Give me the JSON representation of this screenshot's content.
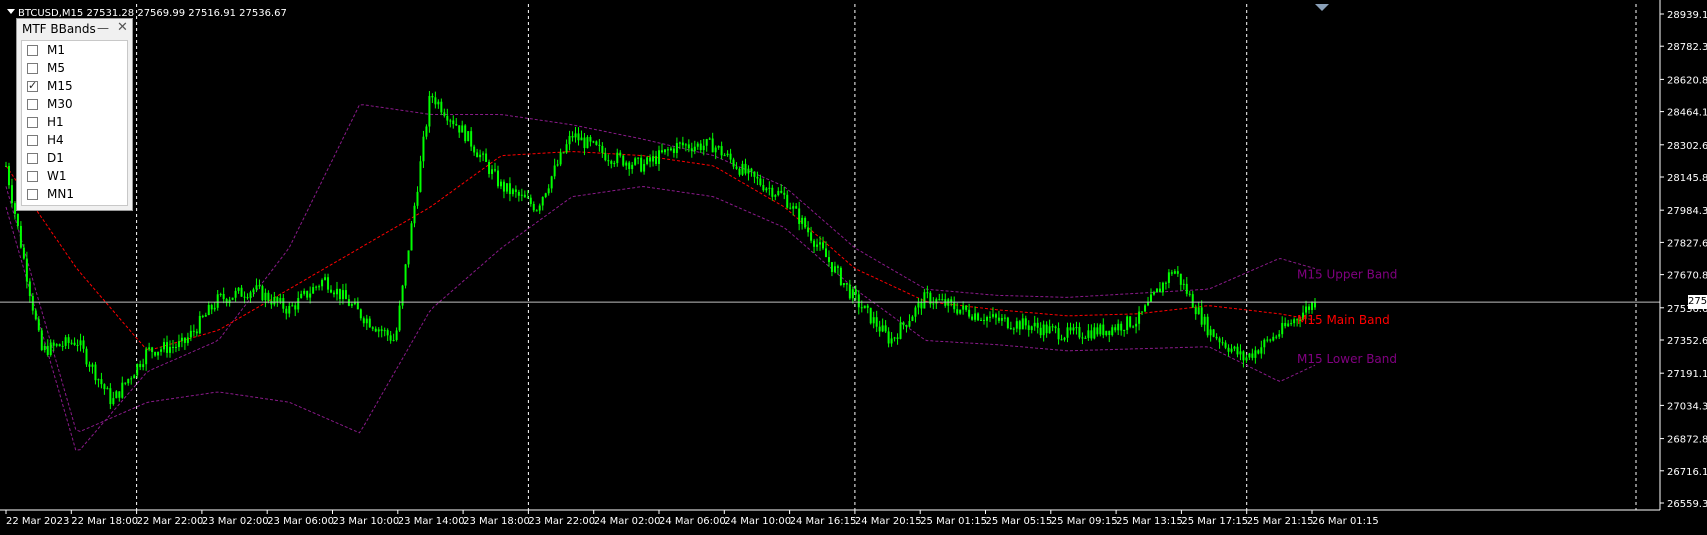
{
  "window": {
    "title": "BTCUSD,M15  27531.28 27569.99 27516.91 27536.67",
    "current_price": "27536.67"
  },
  "indicator_panel": {
    "title": "MTF BBands",
    "minimize_glyph": "—",
    "close_glyph": "✕",
    "items": [
      {
        "label": "M1",
        "checked": false
      },
      {
        "label": "M5",
        "checked": false
      },
      {
        "label": "M15",
        "checked": true
      },
      {
        "label": "M30",
        "checked": false
      },
      {
        "label": "H1",
        "checked": false
      },
      {
        "label": "H4",
        "checked": false
      },
      {
        "label": "D1",
        "checked": false
      },
      {
        "label": "W1",
        "checked": false
      },
      {
        "label": "MN1",
        "checked": false
      }
    ]
  },
  "chart_data": {
    "type": "candlestick",
    "symbol": "BTCUSD",
    "timeframe": "M15",
    "y_ticks": [
      "28939.10",
      "28782.35",
      "28620.80",
      "28464.10",
      "28302.60",
      "28145.85",
      "27984.35",
      "27827.60",
      "27670.80",
      "27536.67",
      "27352.60",
      "27191.10",
      "27034.35",
      "26872.80",
      "26716.10",
      "26559.35"
    ],
    "y_tick_values": [
      28939.1,
      28782.35,
      28620.8,
      28464.1,
      28302.6,
      28145.85,
      27984.35,
      27827.6,
      27670.8,
      27509.35,
      27352.6,
      27191.1,
      27034.35,
      26872.8,
      26716.1,
      26559.35
    ],
    "ylim": [
      26550,
      28960
    ],
    "x_ticks": [
      "22 Mar 2023",
      "22 Mar 18:00",
      "22 Mar 22:00",
      "23 Mar 02:00",
      "23 Mar 06:00",
      "23 Mar 10:00",
      "23 Mar 14:00",
      "23 Mar 18:00",
      "23 Mar 22:00",
      "24 Mar 02:00",
      "24 Mar 06:00",
      "24 Mar 10:00",
      "24 Mar 16:15",
      "24 Mar 20:15",
      "25 Mar 01:15",
      "25 Mar 05:15",
      "25 Mar 09:15",
      "25 Mar 13:15",
      "25 Mar 17:15",
      "25 Mar 21:15",
      "26 Mar 01:15"
    ],
    "day_separators_index": [
      2,
      8,
      13,
      19
    ],
    "series_path": [
      [
        0,
        28200
      ],
      [
        1,
        27300
      ],
      [
        2,
        27350
      ],
      [
        3,
        27050
      ],
      [
        4,
        27300
      ],
      [
        5,
        27330
      ],
      [
        6,
        27550
      ],
      [
        7,
        27600
      ],
      [
        8,
        27500
      ],
      [
        9,
        27650
      ],
      [
        10,
        27480
      ],
      [
        11,
        27350
      ],
      [
        12,
        28550
      ],
      [
        13,
        28350
      ],
      [
        14,
        28100
      ],
      [
        15,
        28000
      ],
      [
        16,
        28350
      ],
      [
        17,
        28250
      ],
      [
        18,
        28200
      ],
      [
        19,
        28300
      ],
      [
        20,
        28300
      ],
      [
        21,
        28150
      ],
      [
        22,
        28050
      ],
      [
        23,
        27800
      ],
      [
        24,
        27550
      ],
      [
        25,
        27350
      ],
      [
        26,
        27560
      ],
      [
        27,
        27500
      ],
      [
        28,
        27450
      ],
      [
        29,
        27420
      ],
      [
        30,
        27380
      ],
      [
        31,
        27400
      ],
      [
        32,
        27450
      ],
      [
        33,
        27700
      ],
      [
        34,
        27400
      ],
      [
        35,
        27260
      ],
      [
        36,
        27390
      ],
      [
        37,
        27540
      ]
    ],
    "upper_band": [
      [
        0,
        28000
      ],
      [
        2,
        26800
      ],
      [
        4,
        27200
      ],
      [
        6,
        27350
      ],
      [
        8,
        27800
      ],
      [
        10,
        28500
      ],
      [
        12,
        28450
      ],
      [
        14,
        28450
      ],
      [
        16,
        28400
      ],
      [
        18,
        28330
      ],
      [
        20,
        28250
      ],
      [
        22,
        28100
      ],
      [
        24,
        27800
      ],
      [
        26,
        27600
      ],
      [
        28,
        27570
      ],
      [
        30,
        27560
      ],
      [
        32,
        27580
      ],
      [
        34,
        27600
      ],
      [
        36,
        27750
      ],
      [
        37,
        27700
      ]
    ],
    "main_band": [
      [
        0,
        28200
      ],
      [
        2,
        27700
      ],
      [
        4,
        27300
      ],
      [
        6,
        27400
      ],
      [
        8,
        27600
      ],
      [
        10,
        27800
      ],
      [
        12,
        28000
      ],
      [
        14,
        28250
      ],
      [
        16,
        28270
      ],
      [
        18,
        28250
      ],
      [
        20,
        28200
      ],
      [
        22,
        28000
      ],
      [
        24,
        27700
      ],
      [
        26,
        27540
      ],
      [
        28,
        27500
      ],
      [
        30,
        27470
      ],
      [
        32,
        27480
      ],
      [
        34,
        27520
      ],
      [
        36,
        27480
      ],
      [
        37,
        27450
      ]
    ],
    "lower_band": [
      [
        0,
        28100
      ],
      [
        2,
        26900
      ],
      [
        4,
        27050
      ],
      [
        6,
        27100
      ],
      [
        8,
        27050
      ],
      [
        10,
        26900
      ],
      [
        12,
        27500
      ],
      [
        14,
        27800
      ],
      [
        16,
        28050
      ],
      [
        18,
        28100
      ],
      [
        20,
        28050
      ],
      [
        22,
        27900
      ],
      [
        24,
        27600
      ],
      [
        26,
        27350
      ],
      [
        28,
        27330
      ],
      [
        30,
        27300
      ],
      [
        32,
        27310
      ],
      [
        34,
        27320
      ],
      [
        36,
        27150
      ],
      [
        37,
        27230
      ]
    ],
    "band_labels": {
      "upper": "M15 Upper Band",
      "main": "M15 Main Band",
      "lower": "M15 Lower Band"
    },
    "colors": {
      "background": "#000000",
      "candle": "#00ff00",
      "upper_band": "#8a1a8a",
      "main_band": "#ff0000",
      "lower_band": "#8a1a8a",
      "upper_label": "#800080",
      "main_label": "#ff0000",
      "lower_label": "#800080",
      "grid_separator": "#ffffff",
      "axis_text": "#ffffff",
      "price_line": "#c0c0c0"
    }
  }
}
